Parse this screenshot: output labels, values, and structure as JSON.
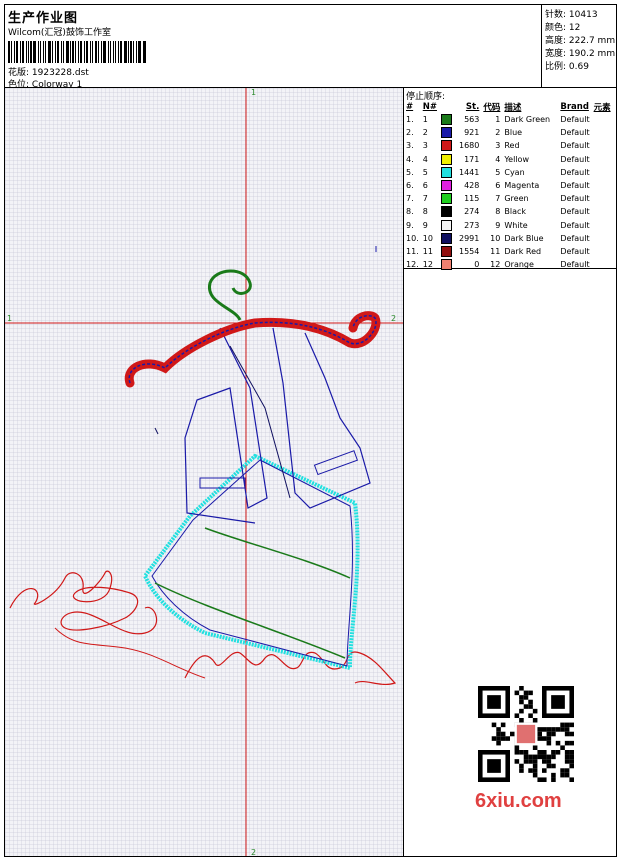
{
  "header": {
    "title": "生产作业图",
    "software": "Wilcom(汇冠)鼓饰工作室",
    "design_file_label": "花版:",
    "design_file": "1923228.dst",
    "colorway_label": "色位:",
    "colorway": "Colorway 1"
  },
  "stats": {
    "stitches_label": "针数:",
    "stitches": "10413",
    "colors_label": "颜色:",
    "colors": "12",
    "height_label": "高度:",
    "height": "222.7 mm",
    "width_label": "宽度:",
    "width": "190.2 mm",
    "scale_label": "比例:",
    "scale": "0.69"
  },
  "stop_sequence": {
    "heading": "停止顺序:",
    "columns": [
      "#",
      "N#",
      "St.",
      "代码",
      "描述",
      "Brand",
      "元素"
    ],
    "rows": [
      {
        "idx": "1.",
        "n": "1",
        "st": "563",
        "code": "1",
        "desc": "Dark Green",
        "brand": "Default",
        "color": "#1a7a1a"
      },
      {
        "idx": "2.",
        "n": "2",
        "st": "921",
        "code": "2",
        "desc": "Blue",
        "brand": "Default",
        "color": "#1a1aa8"
      },
      {
        "idx": "3.",
        "n": "3",
        "st": "1680",
        "code": "3",
        "desc": "Red",
        "brand": "Default",
        "color": "#d01818"
      },
      {
        "idx": "4.",
        "n": "4",
        "st": "171",
        "code": "4",
        "desc": "Yellow",
        "brand": "Default",
        "color": "#f0f000"
      },
      {
        "idx": "5.",
        "n": "5",
        "st": "1441",
        "code": "5",
        "desc": "Cyan",
        "brand": "Default",
        "color": "#20e0e0"
      },
      {
        "idx": "6.",
        "n": "6",
        "st": "428",
        "code": "6",
        "desc": "Magenta",
        "brand": "Default",
        "color": "#e020e0"
      },
      {
        "idx": "7.",
        "n": "7",
        "st": "115",
        "code": "7",
        "desc": "Green",
        "brand": "Default",
        "color": "#20d020"
      },
      {
        "idx": "8.",
        "n": "8",
        "st": "274",
        "code": "8",
        "desc": "Black",
        "brand": "Default",
        "color": "#000000"
      },
      {
        "idx": "9.",
        "n": "9",
        "st": "273",
        "code": "9",
        "desc": "White",
        "brand": "Default",
        "color": "#f4f4f4"
      },
      {
        "idx": "10.",
        "n": "10",
        "st": "2991",
        "code": "10",
        "desc": "Dark Blue",
        "brand": "Default",
        "color": "#101060"
      },
      {
        "idx": "11.",
        "n": "11",
        "st": "1554",
        "code": "11",
        "desc": "Dark Red",
        "brand": "Default",
        "color": "#901010"
      },
      {
        "idx": "12.",
        "n": "12",
        "st": "0",
        "code": "12",
        "desc": "Orange",
        "brand": "Default",
        "color": "#f08070"
      }
    ]
  },
  "canvas": {
    "axis_top": "1",
    "axis_bottom": "2",
    "axis_left": "1",
    "axis_right": "2"
  },
  "watermark": "6xiu.com"
}
